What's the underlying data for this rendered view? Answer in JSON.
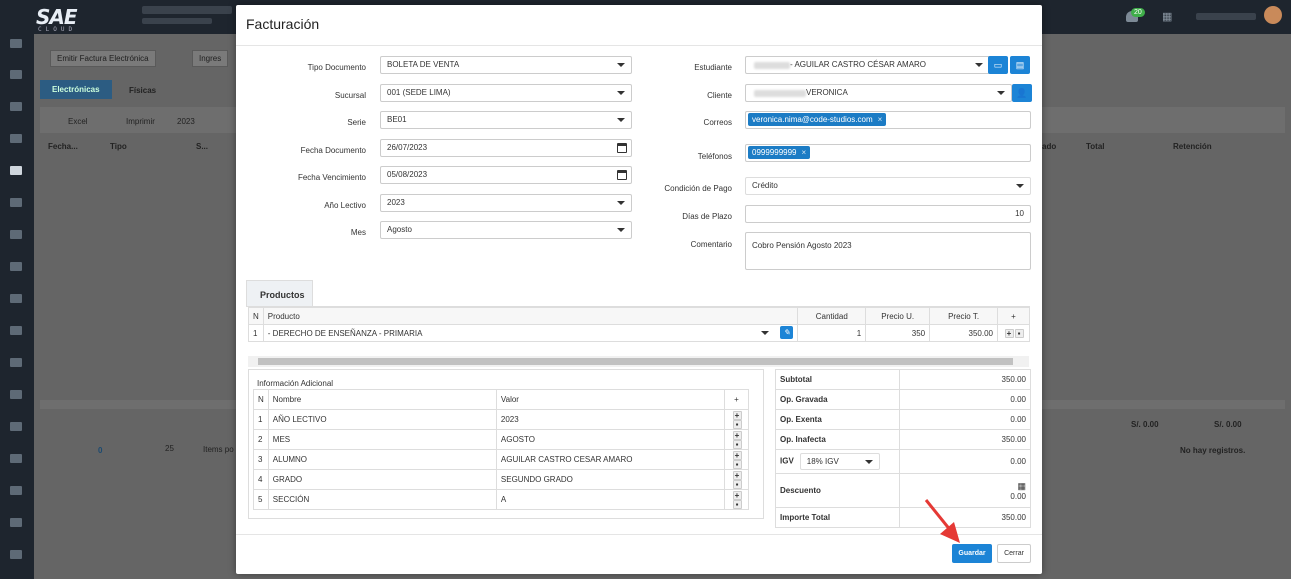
{
  "app": {
    "logo": "SAE",
    "logo_sub": "CLOUD",
    "notif_count": "20"
  },
  "background": {
    "emit_button": "Emitir Factura Electrónica",
    "ingreso_button": "Ingres",
    "tab_electronicas": "Electrónicas",
    "tab_fisicas": "Físicas",
    "excel": "Excel",
    "imprimir": "Imprimir",
    "year": "2023",
    "col_fecha": "Fecha...",
    "col_tipo": "Tipo",
    "col_s": "S...",
    "col_ado": "ado",
    "col_total": "Total",
    "col_retencion": "Retención",
    "sum_total": "S/. 0.00",
    "sum_retencion": "S/. 0.00",
    "page_num": "0",
    "page_size": "25",
    "items_por": "Items po",
    "no_records": "No hay registros."
  },
  "modal": {
    "title": "Facturación",
    "form": {
      "tipo_documento": {
        "label": "Tipo Documento",
        "value": "BOLETA DE VENTA"
      },
      "sucursal": {
        "label": "Sucursal",
        "value": "001 (SEDE LIMA)"
      },
      "serie": {
        "label": "Serie",
        "value": "BE01"
      },
      "fecha_documento": {
        "label": "Fecha Documento",
        "value": "26/07/2023"
      },
      "fecha_vencimiento": {
        "label": "Fecha Vencimiento",
        "value": "05/08/2023"
      },
      "anio_lectivo": {
        "label": "Año Lectivo",
        "value": "2023"
      },
      "mes": {
        "label": "Mes",
        "value": "Agosto"
      },
      "estudiante": {
        "label": "Estudiante",
        "value": "- AGUILAR CASTRO CÉSAR AMARO"
      },
      "cliente": {
        "label": "Cliente",
        "value": "VERONICA"
      },
      "correos": {
        "label": "Correos",
        "chip": "veronica.nima@code-studios.com"
      },
      "telefonos": {
        "label": "Teléfonos",
        "chip": "0999999999"
      },
      "condicion_pago": {
        "label": "Condición de Pago",
        "value": "Crédito"
      },
      "dias_plazo": {
        "label": "Días de Plazo",
        "value": "10"
      },
      "comentario": {
        "label": "Comentario",
        "value": "Cobro Pensión Agosto 2023"
      }
    },
    "products_tab": "Productos",
    "products": {
      "headers": [
        "N",
        "Producto",
        "Cantidad",
        "Precio U.",
        "Precio T.",
        "+"
      ],
      "rows": [
        {
          "n": "1",
          "producto": "- DERECHO DE ENSEÑANZA - PRIMARIA",
          "cantidad": "1",
          "precio_u": "350",
          "precio_t": "350.00"
        }
      ]
    },
    "info_adicional": {
      "title": "Información Adicional",
      "headers": [
        "N",
        "Nombre",
        "Valor",
        "+"
      ],
      "rows": [
        {
          "n": "1",
          "nombre": "AÑO LECTIVO",
          "valor": "2023"
        },
        {
          "n": "2",
          "nombre": "MES",
          "valor": "AGOSTO"
        },
        {
          "n": "3",
          "nombre": "ALUMNO",
          "valor": "AGUILAR CASTRO CESAR AMARO"
        },
        {
          "n": "4",
          "nombre": "GRADO",
          "valor": "SEGUNDO GRADO"
        },
        {
          "n": "5",
          "nombre": "SECCIÓN",
          "valor": "A"
        }
      ]
    },
    "totals": {
      "subtotal": {
        "label": "Subtotal",
        "value": "350.00"
      },
      "op_gravada": {
        "label": "Op. Gravada",
        "value": "0.00"
      },
      "op_exenta": {
        "label": "Op. Exenta",
        "value": "0.00"
      },
      "op_inafecta": {
        "label": "Op. Inafecta",
        "value": "350.00"
      },
      "igv": {
        "label": "IGV",
        "select": "18% IGV",
        "value": "0.00"
      },
      "descuento": {
        "label": "Descuento",
        "value": "0.00"
      },
      "importe_total": {
        "label": "Importe Total",
        "value": "350.00"
      }
    },
    "buttons": {
      "save": "Guardar",
      "close": "Cerrar"
    }
  },
  "colors": {
    "primary": "#1c84d6",
    "arrow": "#e53935"
  }
}
